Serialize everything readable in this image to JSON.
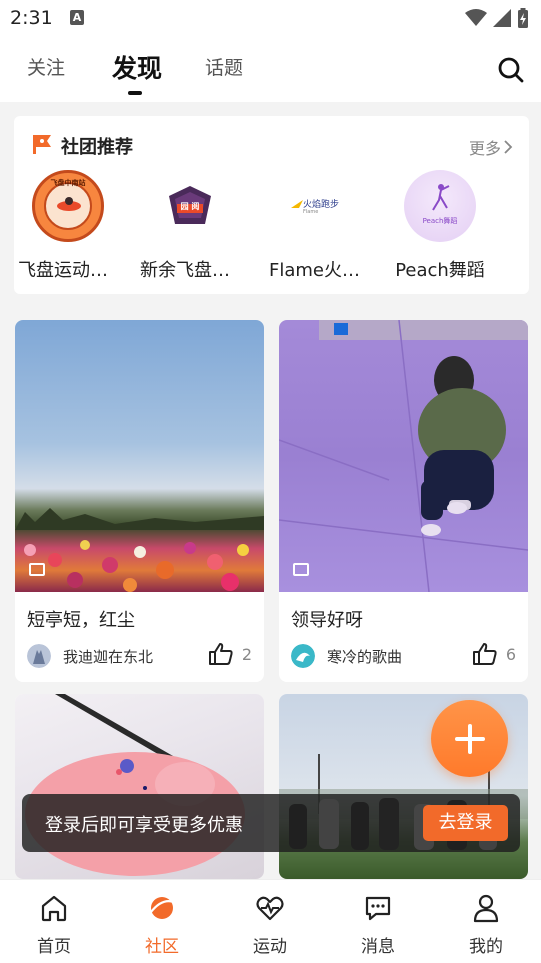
{
  "status_bar": {
    "time": "2:31",
    "notif_letter": "A"
  },
  "tabs": [
    {
      "label": "关注"
    },
    {
      "label": "发现"
    },
    {
      "label": "话题"
    }
  ],
  "clubs": {
    "title": "社团推荐",
    "more_label": "更多",
    "items": [
      {
        "name": "飞盘运动社团",
        "logo_text": "飞盘中南站"
      },
      {
        "name": "新余飞盘社团",
        "logo_text": "园 阅"
      },
      {
        "name": "Flame火焰跑步",
        "logo_text": "火焰跑步",
        "logo_sub": "Flame"
      },
      {
        "name": "Peach舞蹈",
        "logo_text": "Peach舞蹈"
      }
    ]
  },
  "posts": [
    {
      "title": "短亭短，红尘",
      "user": "我迪迦在东北",
      "likes": "2"
    },
    {
      "title": "领导好呀",
      "user": "寒冷的歌曲",
      "likes": "6"
    },
    {
      "title": "",
      "user": "",
      "likes": ""
    },
    {
      "title": "",
      "user": "",
      "likes": ""
    }
  ],
  "toast": {
    "text": "登录后即可享受更多优惠",
    "button": "去登录"
  },
  "bottom_nav": [
    {
      "label": "首页",
      "icon": "home-icon"
    },
    {
      "label": "社区",
      "icon": "community-icon"
    },
    {
      "label": "运动",
      "icon": "heartbeat-icon"
    },
    {
      "label": "消息",
      "icon": "message-icon"
    },
    {
      "label": "我的",
      "icon": "profile-icon"
    }
  ],
  "colors": {
    "accent": "#f26a2a",
    "fab": "#ff8a3c"
  }
}
